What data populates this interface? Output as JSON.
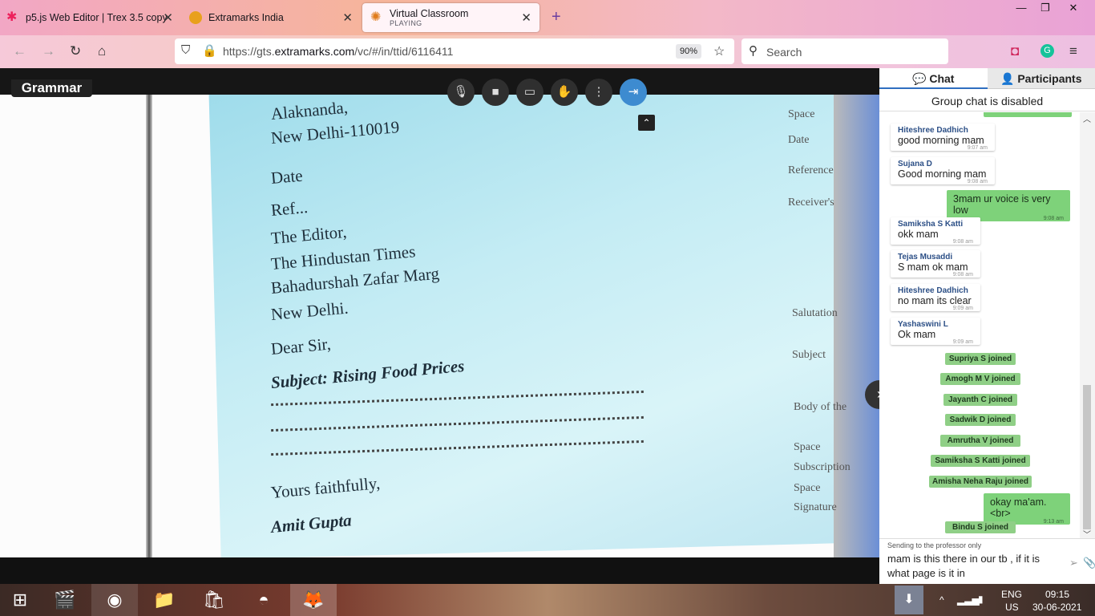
{
  "tabs": [
    {
      "title": "p5.js Web Editor | Trex 3.5 copy"
    },
    {
      "title": "Extramarks India"
    },
    {
      "title": "Virtual Classroom",
      "subtitle": "PLAYING"
    }
  ],
  "new_tab": "+",
  "window": {
    "minimize": "—",
    "restore": "❐",
    "close": "✕"
  },
  "nav": {
    "url_prefix": "https://gts.",
    "url_domain": "extramarks.com",
    "url_path": "/vc/#/in/ttid/6116411",
    "zoom": "90%",
    "search_placeholder": "Search"
  },
  "video": {
    "title": "Grammar",
    "letter_lines": [
      "Alaknanda,",
      "New Delhi-110019",
      "Date",
      "Ref...",
      "The Editor,",
      "The Hindustan Times",
      "Bahadurshah Zafar Marg",
      "New Delhi.",
      "Dear Sir,",
      "Subject: Rising Food Prices",
      "Yours faithfully,",
      "Amit Gupta"
    ],
    "margin_words": [
      "Space",
      "Date",
      "Reference",
      "Receiver's",
      "Salutation",
      "Subject",
      "Body of the",
      "Space",
      "Subscription",
      "Space",
      "Signature"
    ]
  },
  "panel": {
    "tab_chat": "Chat",
    "tab_participants": "Participants",
    "group_chat_status": "Group chat is disabled",
    "messages": [
      {
        "name": "Hiteshree Dadhich",
        "text": "good morning mam",
        "time": "9:07 am"
      },
      {
        "name": "Sujana D",
        "text": "Good morning mam",
        "time": "9:08 am"
      },
      {
        "mine": true,
        "text": "3mam ur voice is very low",
        "time": "9:08 am"
      },
      {
        "name": "Samiksha S Katti",
        "text": "okk mam",
        "time": "9:08 am"
      },
      {
        "name": "Tejas Musaddi",
        "text": "S mam ok mam",
        "time": "9:08 am"
      },
      {
        "name": "Hiteshree Dadhich",
        "text": "no mam its clear",
        "time": "9:09 am"
      },
      {
        "name": "Yashaswini L",
        "text": "Ok mam",
        "time": "9:09 am"
      }
    ],
    "joins": [
      "Supriya S  joined",
      "Amogh M V  joined",
      "Jayanth C  joined",
      "Sadwik D  joined",
      "Amrutha V  joined",
      "Samiksha S Katti  joined",
      "Amisha Neha Raju  joined"
    ],
    "my_last": {
      "text": "okay ma'am.<br>",
      "time": "9:13 am"
    },
    "last_join": "Bindu S  joined",
    "sending_to": "Sending to the professor only",
    "draft": "mam is this there in our tb , if it is what page is it in"
  },
  "taskbar": {
    "lang_top": "ENG",
    "lang_bottom": "US",
    "time": "09:15",
    "date": "30-06-2021"
  },
  "colors": {
    "accent": "#2f6fc0",
    "my_bubble": "#7ed27a",
    "join_badge": "#8fcf86"
  }
}
